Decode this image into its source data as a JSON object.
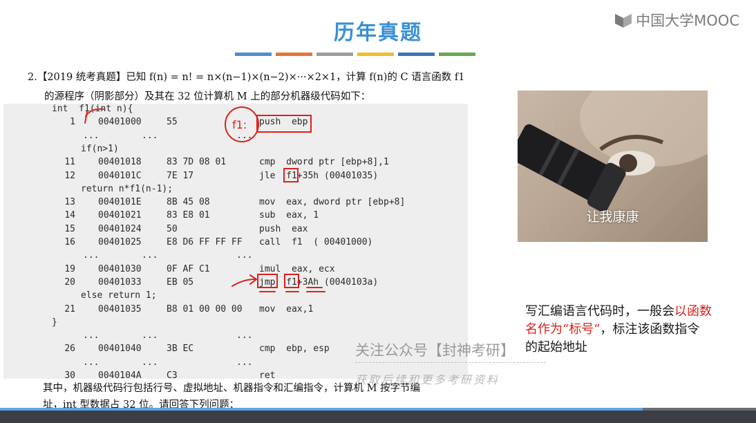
{
  "slide": {
    "title": "历年真题"
  },
  "logo": {
    "text": "中国大学MOOC"
  },
  "accent_bars": [
    "#4d8fcf",
    "#e2773a",
    "#9e9e9e",
    "#efbf2e",
    "#3e73b8",
    "#6aa84f"
  ],
  "question": {
    "line1": "2.【2019 统考真题】已知 f(n) = n! = n×(n−1)×(n−2)×···×2×1，计算 f(n)的 C 语言函数 f1",
    "line2": "的源程序（阴影部分）及其在 32 位计算机 M 上的部分机器级代码如下："
  },
  "code": {
    "header": "int  f1(int n){",
    "rows": [
      {
        "num": "1",
        "addr": "00401000",
        "hex": "55",
        "asm": "push  ebp"
      },
      {
        "dots": [
          "...",
          "...",
          "..."
        ]
      },
      {
        "src": "if(n>1)"
      },
      {
        "num": "11",
        "addr": "00401018",
        "hex": "83 7D 08 01",
        "asm": "cmp  dword ptr [ebp+8],1"
      },
      {
        "num": "12",
        "addr": "0040101C",
        "hex": "7E 17",
        "asm": "jle  f1+35h (00401035)"
      },
      {
        "src": "return n*f1(n-1);"
      },
      {
        "num": "13",
        "addr": "0040101E",
        "hex": "8B 45 08",
        "asm": "mov  eax, dword ptr [ebp+8]"
      },
      {
        "num": "14",
        "addr": "00401021",
        "hex": "83 E8 01",
        "asm": "sub  eax, 1"
      },
      {
        "num": "15",
        "addr": "00401024",
        "hex": "50",
        "asm": "push  eax"
      },
      {
        "num": "16",
        "addr": "00401025",
        "hex": "E8 D6 FF FF FF",
        "asm": "call  f1  ( 00401000)"
      },
      {
        "dots": [
          "...",
          "...",
          "..."
        ]
      },
      {
        "num": "19",
        "addr": "00401030",
        "hex": "0F AF C1",
        "asm": "imul  eax, ecx"
      },
      {
        "num": "20",
        "addr": "00401033",
        "hex": "EB 05",
        "asm": "jmp  f1+3Ah (0040103a)"
      },
      {
        "src": "else return 1;"
      },
      {
        "num": "21",
        "addr": "00401035",
        "hex": "B8 01 00 00 00",
        "asm": "mov  eax,1"
      },
      {
        "close": "}"
      },
      {
        "dots": [
          "...",
          "...",
          "..."
        ]
      },
      {
        "num": "26",
        "addr": "00401040",
        "hex": "3B EC",
        "asm": "cmp  ebp, esp"
      },
      {
        "dots": [
          "...",
          "...",
          "..."
        ]
      },
      {
        "num": "30",
        "addr": "0040104A",
        "hex": "C3",
        "asm": "ret"
      }
    ]
  },
  "bottom": {
    "line1": "其中，机器级代码行包括行号、虚拟地址、机器指令和汇编指令，计算机 M 按字节编",
    "line2": "址，int 型数据占 32 位。请回答下列问题："
  },
  "meme": {
    "caption": "让我康康"
  },
  "note": {
    "part1": "写汇编语言代码时，一般会",
    "highlight": "以函数名作为“标号”",
    "part2": "，标注该函数指令的起始地址"
  },
  "handwriting": {
    "label": "f1:"
  },
  "watermark": {
    "text": "关注公众号【封神考研】",
    "sub": "获取后续和更多考研资料"
  },
  "annotation_color": "#d9221c"
}
